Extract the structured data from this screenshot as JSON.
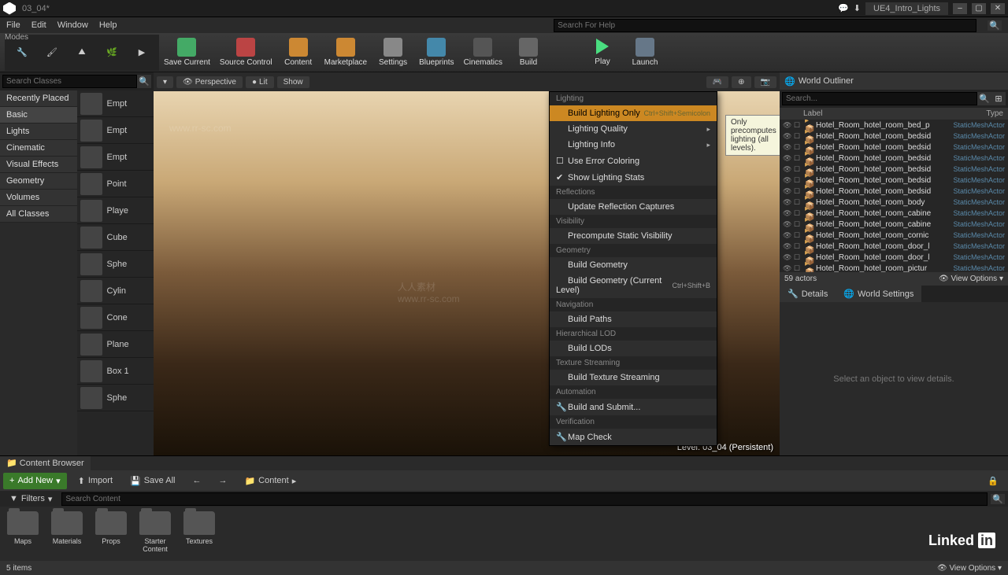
{
  "titlebar": {
    "title": "03_04*",
    "project": "UE4_Intro_Lights"
  },
  "menubar": [
    "File",
    "Edit",
    "Window",
    "Help"
  ],
  "toolbar": {
    "modes_label": "Modes",
    "buttons": [
      "Save Current",
      "Source Control",
      "Content",
      "Marketplace",
      "Settings",
      "Blueprints",
      "Cinematics",
      "Build",
      "Play",
      "Launch"
    ]
  },
  "left": {
    "search_placeholder": "Search Classes",
    "categories": [
      "Recently Placed",
      "Basic",
      "Lights",
      "Cinematic",
      "Visual Effects",
      "Geometry",
      "Volumes",
      "All Classes"
    ],
    "selected_cat": "Basic",
    "items": [
      "Empt",
      "Empt",
      "Empt",
      "Point",
      "Playe",
      "Cube",
      "Sphe",
      "Cylin",
      "Cone",
      "Plane",
      "Box 1",
      "Sphe"
    ]
  },
  "viewport": {
    "perspective": "Perspective",
    "lit": "Lit",
    "show": "Show",
    "level": "Level: 03_04 (Persistent)"
  },
  "build_menu": {
    "sections": [
      {
        "title": "Lighting",
        "items": [
          {
            "label": "Build Lighting Only",
            "shortcut": "Ctrl+Shift+Semicolon",
            "hl": true
          },
          {
            "label": "Lighting Quality",
            "sub": true
          },
          {
            "label": "Lighting Info",
            "sub": true
          },
          {
            "label": "Use Error Coloring",
            "check": false
          },
          {
            "label": "Show Lighting Stats",
            "check": true
          }
        ]
      },
      {
        "title": "Reflections",
        "items": [
          {
            "label": "Update Reflection Captures"
          }
        ]
      },
      {
        "title": "Visibility",
        "items": [
          {
            "label": "Precompute Static Visibility"
          }
        ]
      },
      {
        "title": "Geometry",
        "items": [
          {
            "label": "Build Geometry"
          },
          {
            "label": "Build Geometry (Current Level)",
            "shortcut": "Ctrl+Shift+B"
          }
        ]
      },
      {
        "title": "Navigation",
        "items": [
          {
            "label": "Build Paths"
          }
        ]
      },
      {
        "title": "Hierarchical LOD",
        "items": [
          {
            "label": "Build LODs"
          }
        ]
      },
      {
        "title": "Texture Streaming",
        "items": [
          {
            "label": "Build Texture Streaming"
          }
        ]
      },
      {
        "title": "Automation",
        "items": [
          {
            "label": "Build and Submit...",
            "icon": true
          }
        ]
      },
      {
        "title": "Verification",
        "items": [
          {
            "label": "Map Check",
            "icon": true
          }
        ]
      }
    ],
    "tooltip": "Only precomputes lighting (all levels)."
  },
  "outliner": {
    "title": "World Outliner",
    "search_placeholder": "Search...",
    "search_help_placeholder": "Search For Help",
    "col_label": "Label",
    "col_type": "Type",
    "rows": [
      {
        "label": "Hotel_Room_hotel_room_bed_p",
        "type": "StaticMeshActor"
      },
      {
        "label": "Hotel_Room_hotel_room_bedsid",
        "type": "StaticMeshActor"
      },
      {
        "label": "Hotel_Room_hotel_room_bedsid",
        "type": "StaticMeshActor"
      },
      {
        "label": "Hotel_Room_hotel_room_bedsid",
        "type": "StaticMeshActor"
      },
      {
        "label": "Hotel_Room_hotel_room_bedsid",
        "type": "StaticMeshActor"
      },
      {
        "label": "Hotel_Room_hotel_room_bedsid",
        "type": "StaticMeshActor"
      },
      {
        "label": "Hotel_Room_hotel_room_bedsid",
        "type": "StaticMeshActor"
      },
      {
        "label": "Hotel_Room_hotel_room_body",
        "type": "StaticMeshActor"
      },
      {
        "label": "Hotel_Room_hotel_room_cabine",
        "type": "StaticMeshActor"
      },
      {
        "label": "Hotel_Room_hotel_room_cabine",
        "type": "StaticMeshActor"
      },
      {
        "label": "Hotel_Room_hotel_room_cornic",
        "type": "StaticMeshActor"
      },
      {
        "label": "Hotel_Room_hotel_room_door_l",
        "type": "StaticMeshActor"
      },
      {
        "label": "Hotel_Room_hotel_room_door_l",
        "type": "StaticMeshActor"
      },
      {
        "label": "Hotel_Room_hotel_room_pictur",
        "type": "StaticMeshActor"
      }
    ],
    "actor_count": "59 actors",
    "view_options": "View Options"
  },
  "details": {
    "tab1": "Details",
    "tab2": "World Settings",
    "empty": "Select an object to view details."
  },
  "cb": {
    "title": "Content Browser",
    "add_new": "Add New",
    "import": "Import",
    "save_all": "Save All",
    "path": "Content",
    "filters": "Filters",
    "search_placeholder": "Search Content",
    "folders": [
      "Maps",
      "Materials",
      "Props",
      "Starter Content",
      "Textures"
    ],
    "items_count": "5 items",
    "view_options": "View Options"
  }
}
